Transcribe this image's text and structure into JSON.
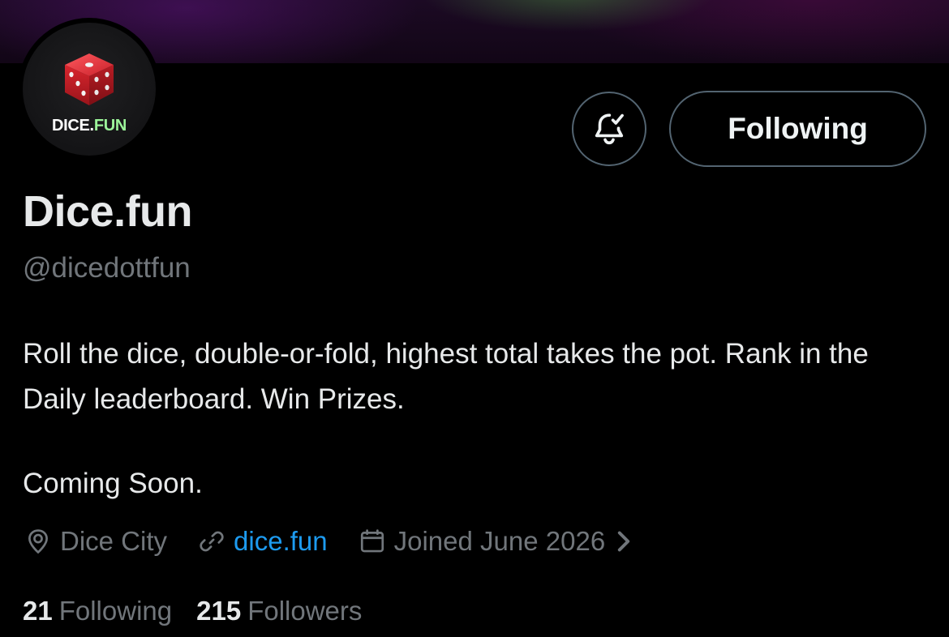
{
  "profile": {
    "avatar_text_main": "DICE",
    "avatar_text_dot": ".",
    "avatar_text_fun": "FUN",
    "display_name": "Dice.fun",
    "handle": "@dicedottfun",
    "bio_line1": "Roll the dice, double-or-fold, highest total takes the pot. Rank in the Daily leaderboard. Win Prizes.",
    "bio_line2": "Coming Soon.",
    "location": "Dice City",
    "website": "dice.fun",
    "joined": "Joined June 2026"
  },
  "actions": {
    "notify_icon": "bell-check-icon",
    "follow_label": "Following"
  },
  "stats": {
    "following_count": "21",
    "following_label": "Following",
    "followers_count": "215",
    "followers_label": "Followers"
  },
  "colors": {
    "background": "#000000",
    "text_primary": "#e7e9ea",
    "text_secondary": "#71767b",
    "link": "#1d9bf0",
    "button_border": "#536471",
    "die_red": "#d42a32"
  }
}
